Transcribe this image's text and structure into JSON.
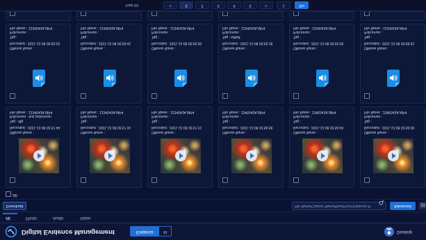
{
  "header": {
    "title": "Digital Evidence Management",
    "toggle": [
      "Evidence",
      "AI"
    ],
    "user": "Desktop"
  },
  "tabs": [
    "All",
    "Photo",
    "Audio",
    "Video"
  ],
  "active_tab": "All",
  "toolbar": {
    "download": "Download",
    "search_placeholder": "File Name/Capture Name/Rear/Front Evidence N",
    "advanced": "Advanced"
  },
  "select_all": "All",
  "field_labels": {
    "offense": "Offense Name :",
    "recorded": "Recorded :",
    "tag": "Tag :",
    "policeman": "Policeman :",
    "file": "File Name :"
  },
  "video_cards": [
    {
      "offense": "",
      "recorded": "2021-12-08 02:57:44",
      "tag": "dfg",
      "policeman": "test policeman",
      "file": "1234543A.MP4"
    },
    {
      "offense": "",
      "recorded": "2021-12-08 02:57:31",
      "tag": "",
      "policeman": "",
      "file": "1234543A.MP4"
    },
    {
      "offense": "",
      "recorded": "2021-12-08 02:57:21",
      "tag": "",
      "policeman": "",
      "file": "1234543A.MP4"
    },
    {
      "offense": "",
      "recorded": "2021-12-08 02:56:58",
      "tag": "",
      "policeman": "",
      "file": "2345543A.MP4"
    },
    {
      "offense": "",
      "recorded": "2021-12-08 02:56:43",
      "tag": "",
      "policeman": "",
      "file": "2345543A.MP4"
    },
    {
      "offense": "",
      "recorded": "2021-12-08 02:56:30",
      "tag": "",
      "policeman": "",
      "file": "2345543A.MP4"
    }
  ],
  "audio_cards": [
    {
      "offense": "",
      "recorded": "2021-12-08 00:59:52",
      "tag": "",
      "policeman": "",
      "file": "1234543A.MP4"
    },
    {
      "offense": "",
      "recorded": "2021-12-08 00:59:41",
      "tag": "",
      "policeman": "",
      "file": "1234543A.MP4"
    },
    {
      "offense": "",
      "recorded": "2021-12-08 00:59:30",
      "tag": "",
      "policeman": "",
      "file": "1234543A.MP4"
    },
    {
      "offense": "",
      "recorded": "2021-12-08 00:59:18",
      "tag": "sdfsdf",
      "policeman": "",
      "file": "1234543A.MP4"
    },
    {
      "offense": "",
      "recorded": "2021-12-08 00:59:05",
      "tag": "",
      "policeman": "",
      "file": "1234543A.MP4"
    },
    {
      "offense": "",
      "recorded": "2021-12-08 00:58:51",
      "tag": "",
      "policeman": "",
      "file": "1234543A.MP4"
    }
  ],
  "pagination": {
    "total": "Total 60",
    "prev": "<",
    "pages": [
      "1",
      "2",
      "3",
      "4",
      "5"
    ],
    "current": "1",
    "next": ">",
    "jump_value": "1",
    "go": "Go"
  },
  "icons": {
    "logo": "evidence-logo-icon",
    "avatar": "user-avatar-icon",
    "search": "search-icon",
    "list": "list-icon",
    "audio": "audio-file-icon",
    "play": "play-icon"
  },
  "colors": {
    "background": "#0a1231",
    "accent": "#1f6fd6",
    "card": "#0d1738",
    "audio_icon": "#1b8de4"
  }
}
